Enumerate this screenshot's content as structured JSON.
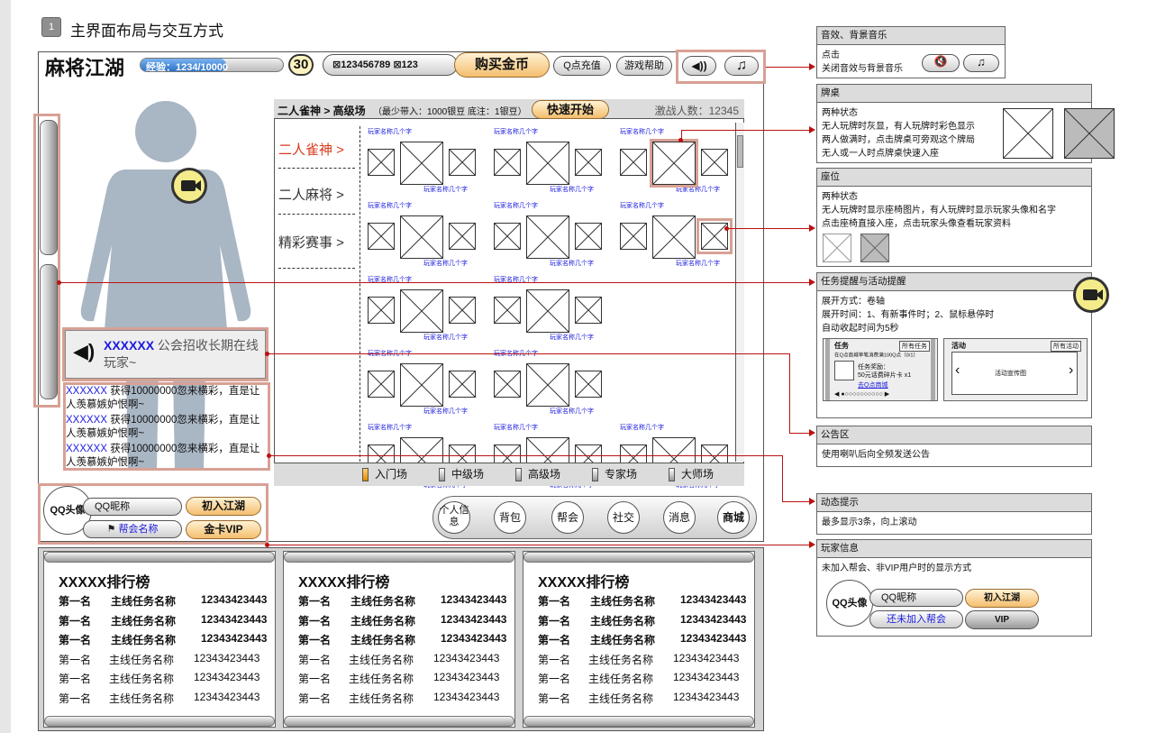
{
  "section": {
    "number": "1",
    "title": "主界面布局与交互方式"
  },
  "header": {
    "logo": "麻将江湖",
    "xp_label": "经验：1234/10000",
    "xp_fraction": 0.6,
    "level": "30",
    "id_text": "⊠123456789 ⊠123",
    "buy_label": "购买金币",
    "recharge_label": "Q点充值",
    "help_label": "游戏帮助",
    "sound_icon": "speaker-icon",
    "music_icon": "music-note-icon"
  },
  "hall": {
    "breadcrumb": "二人雀神 > 高级场",
    "breadcrumb_note": "（最少带入：1000银豆  底注：1银豆）",
    "quick_start": "快速开始",
    "players": "激战人数：12345",
    "categories": [
      "二人雀神 >",
      "二人麻将 >",
      "精彩赛事 >"
    ],
    "seat_name": "玩家名称几个字",
    "tabs": [
      "入门场",
      "中级场",
      "高级场",
      "专家场",
      "大师场"
    ]
  },
  "notice": {
    "name": "XXXXXX",
    "text": " 公会招收长期在线玩家~"
  },
  "feed": [
    {
      "name": "XXXXXX",
      "text": " 获得10000000忽来横彩，直是让人羡慕嫉妒恨啊~"
    },
    {
      "name": "XXXXXX",
      "text": " 获得10000000忽来横彩，直是让人羡慕嫉妒恨啊~"
    },
    {
      "name": "XXXXXX",
      "text": " 获得10000000忽来横彩，直是让人羡慕嫉妒恨啊~"
    }
  ],
  "player": {
    "head": "QQ头像",
    "nick": "QQ昵称",
    "guild": "帮会名称",
    "join": "初入江湖",
    "vip": "金卡VIP"
  },
  "bottom_menu": [
    "个人信息",
    "背包",
    "帮会",
    "社交",
    "消息",
    "商城"
  ],
  "ranks": [
    {
      "title": "XXXXX排行榜",
      "rows": [
        [
          "第一名",
          "主线任务名称",
          "12343423443"
        ],
        [
          "第一名",
          "主线任务名称",
          "12343423443"
        ],
        [
          "第一名",
          "主线任务名称",
          "12343423443"
        ],
        [
          "第一名",
          "主线任务名称",
          "12343423443"
        ],
        [
          "第一名",
          "主线任务名称",
          "12343423443"
        ],
        [
          "第一名",
          "主线任务名称",
          "12343423443"
        ]
      ]
    },
    {
      "title": "XXXXX排行榜",
      "rows": [
        [
          "第一名",
          "主线任务名称",
          "12343423443"
        ],
        [
          "第一名",
          "主线任务名称",
          "12343423443"
        ],
        [
          "第一名",
          "主线任务名称",
          "12343423443"
        ],
        [
          "第一名",
          "主线任务名称",
          "12343423443"
        ],
        [
          "第一名",
          "主线任务名称",
          "12343423443"
        ],
        [
          "第一名",
          "主线任务名称",
          "12343423443"
        ]
      ]
    },
    {
      "title": "XXXXX排行榜",
      "rows": [
        [
          "第一名",
          "主线任务名称",
          "12343423443"
        ],
        [
          "第一名",
          "主线任务名称",
          "12343423443"
        ],
        [
          "第一名",
          "主线任务名称",
          "12343423443"
        ],
        [
          "第一名",
          "主线任务名称",
          "12343423443"
        ],
        [
          "第一名",
          "主线任务名称",
          "12343423443"
        ],
        [
          "第一名",
          "主线任务名称",
          "12343423443"
        ]
      ]
    }
  ],
  "panels": {
    "sound": {
      "title": "音效、背景音乐",
      "body": [
        "点击",
        "关闭音效与背景音乐"
      ]
    },
    "table": {
      "title": "牌桌",
      "body": [
        "两种状态",
        "无人玩牌时灰显，有人玩牌时彩色显示",
        "两人做满时，点击牌桌可旁观这个牌局",
        "无人或一人时点牌桌快速入座"
      ]
    },
    "seat": {
      "title": "座位",
      "body": [
        "两种状态",
        "无人玩牌时显示座椅图片，有人玩牌时显示玩家头像和名字",
        "点击座椅直接入座，点击玩家头像查看玩家资料"
      ]
    },
    "task": {
      "title": "任务提醒与活动提醒",
      "body": [
        "展开方式：卷轴",
        "展开时间：1、有新事件时；2、鼠标悬停时",
        "自动收起时间为5秒"
      ],
      "task_label": "任务",
      "activity_label": "活动",
      "task_btn": "所有任务",
      "activity_btn": "所有活动",
      "task_line": "在Q点商城单笔消费满100Q点（0/1）",
      "task_reward": "任务奖励：",
      "task_reward2": "50元话费碎片卡 x1",
      "task_link": "去Q点商城",
      "activity_text": "活动宣传图"
    },
    "notice": {
      "title": "公告区",
      "body": [
        "使用喇叭后向全频发送公告"
      ]
    },
    "dynamic": {
      "title": "动态提示",
      "body": [
        "最多显示3条，向上滚动"
      ]
    },
    "player": {
      "title": "玩家信息",
      "body": [
        "未加入帮会、非VIP用户时的显示方式"
      ],
      "head": "QQ头像",
      "nick": "QQ昵称",
      "guild": "还未加入帮会",
      "join": "初入江湖",
      "vip": "VIP"
    }
  },
  "colors": {
    "accent": "#d7a195",
    "link": "#1a1adf",
    "red": "#b11111",
    "orange": "#f4be6e"
  }
}
